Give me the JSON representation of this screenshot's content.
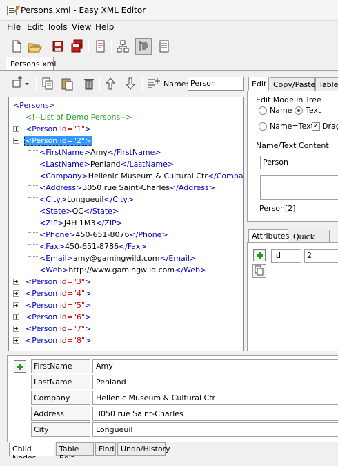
{
  "window": {
    "title": "Persons.xml - Easy XML Editor"
  },
  "menu": [
    "File",
    "Edit",
    "Tools",
    "View",
    "Help"
  ],
  "toolbar": {
    "icons": [
      "new-icon",
      "open-icon",
      "save-icon",
      "save-all-icon",
      "export-icon",
      "tree-view-icon",
      "tree-text-icon",
      "text-view-icon"
    ]
  },
  "file_tab": "Persons.xml",
  "tree_toolbar": {
    "name_label": "Name:",
    "name_value": "Person"
  },
  "tree": {
    "rows": [
      {
        "text": "<Persons>"
      },
      {
        "text": "<!--List of Demo Persons-->"
      },
      {
        "open": "<Person ",
        "attr": "id=\"1\"",
        "close": ">"
      },
      {
        "open": "<Person ",
        "attr": "id=\"2\"",
        "close": ">"
      },
      {
        "t1": "<FirstName>",
        "v": "Amy",
        "t2": "</FirstName>"
      },
      {
        "t1": "<LastName>",
        "v": "Penland",
        "t2": "</LastName>"
      },
      {
        "t1": "<Company>",
        "v": "Hellenic Museum & Cultural Ctr",
        "t2": "</Company>"
      },
      {
        "t1": "<Address>",
        "v": "3050 rue Saint-Charles",
        "t2": "</Address>"
      },
      {
        "t1": "<City>",
        "v": "Longueuil",
        "t2": "</City>"
      },
      {
        "t1": "<State>",
        "v": "QC",
        "t2": "</State>"
      },
      {
        "t1": "<ZIP>",
        "v": "J4H 1M3",
        "t2": "</ZIP>"
      },
      {
        "t1": "<Phone>",
        "v": "450-651-8076",
        "t2": "</Phone>"
      },
      {
        "t1": "<Fax>",
        "v": "450-651-8786",
        "t2": "</Fax>"
      },
      {
        "t1": "<Email>",
        "v": "amy@gamingwild.com",
        "t2": "</Email>"
      },
      {
        "t1": "<Web>",
        "v": "http://www.gamingwild.com",
        "t2": "</Web>"
      },
      {
        "open": "<Person ",
        "attr": "id=\"3\"",
        "close": ">"
      },
      {
        "open": "<Person ",
        "attr": "id=\"4\"",
        "close": ">"
      },
      {
        "open": "<Person ",
        "attr": "id=\"5\"",
        "close": ">"
      },
      {
        "open": "<Person ",
        "attr": "id=\"6\"",
        "close": ">"
      },
      {
        "open": "<Person ",
        "attr": "id=\"7\"",
        "close": ">"
      },
      {
        "open": "<Person ",
        "attr": "id=\"8\"",
        "close": ">"
      }
    ]
  },
  "right_tabs": [
    "Edit",
    "Copy/Paste",
    "Table"
  ],
  "edit_panel": {
    "mode_label": "Edit Mode in Tree",
    "radio_name": "Name",
    "radio_text": "Text",
    "radio_nametext": "Name=Text",
    "check_drag": "Drag",
    "content_label": "Name/Text Content",
    "content_value": "Person",
    "path": "Person[2]"
  },
  "attr_tabs": [
    "Attributes",
    "Quick Add"
  ],
  "attributes": [
    {
      "name": "id",
      "value": "2"
    }
  ],
  "child_nodes": [
    {
      "name": "FirstName",
      "value": "Amy"
    },
    {
      "name": "LastName",
      "value": "Penland"
    },
    {
      "name": "Company",
      "value": "Hellenic Museum & Cultural Ctr"
    },
    {
      "name": "Address",
      "value": "3050 rue Saint-Charles"
    },
    {
      "name": "City",
      "value": "Longueuil"
    }
  ],
  "bottom_tabs": [
    "Child Nodes",
    "Table Edit",
    "Find",
    "Undo/History"
  ]
}
